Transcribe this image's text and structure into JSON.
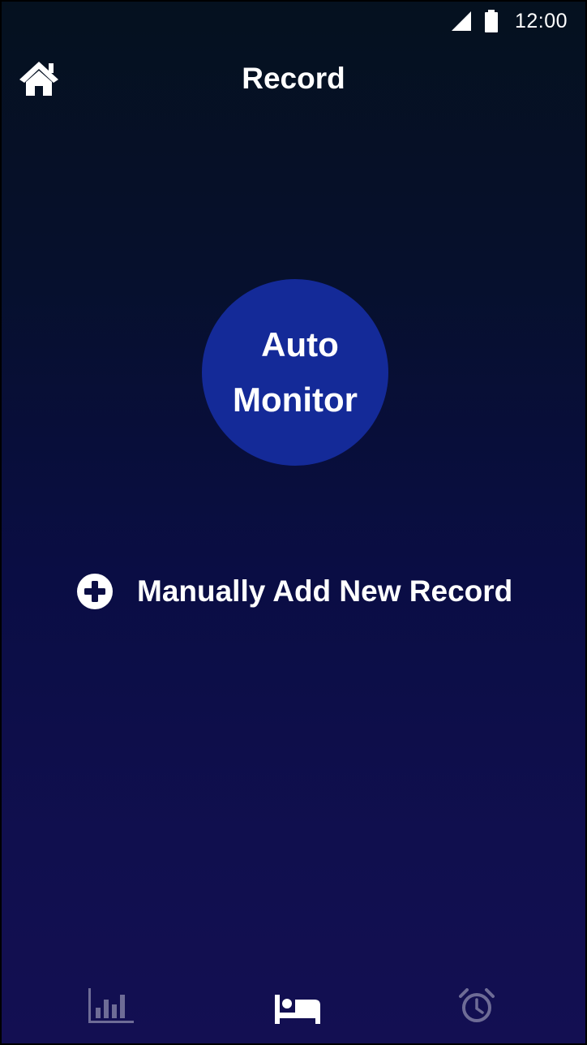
{
  "status_bar": {
    "time": "12:00",
    "icons": [
      "signal-icon",
      "battery-icon"
    ]
  },
  "header": {
    "title": "Record",
    "home_icon": "home-icon"
  },
  "auto_monitor": {
    "line1": "Auto",
    "line2": "Monitor",
    "color": "#142a98"
  },
  "manual_add": {
    "icon": "plus-circle-icon",
    "label": "Manually Add New Record"
  },
  "bottom_nav": {
    "items": [
      {
        "name": "stats",
        "icon": "bar-chart-icon",
        "active": false
      },
      {
        "name": "sleep",
        "icon": "bed-icon",
        "active": true
      },
      {
        "name": "alarm",
        "icon": "alarm-clock-icon",
        "active": false
      }
    ],
    "active_color": "#ffffff",
    "inactive_color": "#6e6c96"
  },
  "colors": {
    "background_top": "#05111f",
    "background_bottom": "#130f52",
    "text": "#ffffff"
  }
}
